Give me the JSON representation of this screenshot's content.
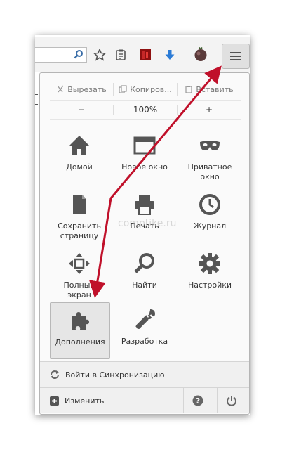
{
  "toolbar": {
    "search_icon": "search-icon",
    "bookmark_star_icon": "star-icon",
    "reading_list_icon": "reading-list-icon",
    "addon_icon": "red-addon-icon",
    "download_icon": "download-arrow-icon",
    "avatar_icon": "tomato-avatar-icon",
    "menu_icon": "hamburger-menu-icon"
  },
  "edit": {
    "cut": "Вырезать",
    "copy": "Копиров...",
    "paste": "Вставить"
  },
  "zoom": {
    "minus": "−",
    "level": "100%",
    "plus": "+"
  },
  "tiles": [
    {
      "label": "Домой",
      "icon": "home-icon"
    },
    {
      "label": "Новое окно",
      "icon": "new-window-icon"
    },
    {
      "label": "Приватное\nокно",
      "icon": "private-mask-icon"
    },
    {
      "label": "Сохранить\nстраницу",
      "icon": "save-page-icon"
    },
    {
      "label": "Печать",
      "icon": "print-icon"
    },
    {
      "label": "Журнал",
      "icon": "history-clock-icon"
    },
    {
      "label": "Полный\nэкран",
      "icon": "fullscreen-icon"
    },
    {
      "label": "Найти",
      "icon": "find-icon"
    },
    {
      "label": "Настройки",
      "icon": "settings-gear-icon"
    },
    {
      "label": "Дополнения",
      "icon": "addons-puzzle-icon"
    },
    {
      "label": "Разработка",
      "icon": "developer-wrench-icon"
    }
  ],
  "sync": {
    "label": "Войти в Синхронизацию"
  },
  "footer": {
    "customize": "Изменить"
  },
  "watermark": "comptike.ru",
  "colors": {
    "arrow": "#c0102a",
    "panel_bg": "#fafafa",
    "highlight": "#e6e6e6"
  }
}
